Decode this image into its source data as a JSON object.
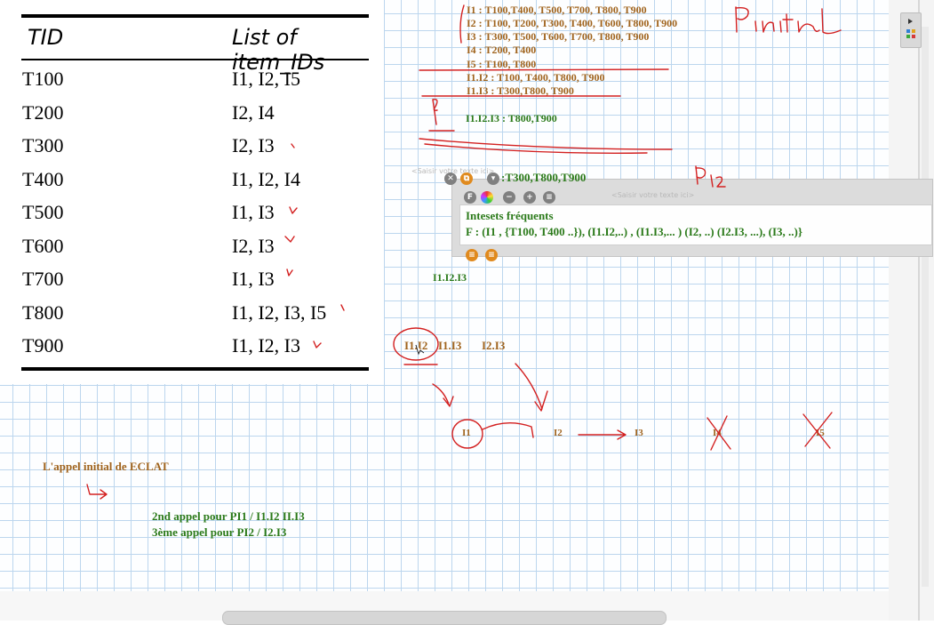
{
  "table": {
    "headers": [
      "TID",
      "List of item_IDs"
    ],
    "rows": [
      [
        "T100",
        "I1, I2, I5"
      ],
      [
        "T200",
        "I2, I4"
      ],
      [
        "T300",
        "I2, I3"
      ],
      [
        "T400",
        "I1, I2, I4"
      ],
      [
        "T500",
        "I1, I3"
      ],
      [
        "T600",
        "I2, I3"
      ],
      [
        "T700",
        "I1, I3"
      ],
      [
        "T800",
        "I1, I2, I3, I5"
      ],
      [
        "T900",
        "I1, I2, I3"
      ]
    ]
  },
  "notes": {
    "tidlists": [
      "I1 : T100,T400, T500, T700, T800, T900",
      "I2 : T100, T200, T300, T400, T600, T800, T900",
      "I3 : T300, T500, T600, T700, T800, T900",
      "I4 : T200, T400",
      "I5 : T100, T800",
      "I1.I2 : T100, T400, T800, T900",
      "I1.I3 : T300,T800, T900"
    ],
    "i1i2i3": "I1.I2.I3 : T800,T900",
    "i2i3_tail": ":T300,T800,T900",
    "i1i2i3_label": "I1.I2.I3",
    "pairs": [
      "I1.I2",
      "I1.I3",
      "I2.I3"
    ],
    "items_row": [
      "I1",
      "I2",
      "I3",
      "I4",
      "I5"
    ],
    "appel_initial": "L'appel initial de ECLAT",
    "second_call": "2nd appel pour PI1 / I1.I2 II.I3",
    "third_call": "3ème appel pour PI2 / I2.I3"
  },
  "textbox": {
    "line1": "Intesets fréquents",
    "line2": "F : (I1 , {T100, T400 ..}), (I1.I2,..) , (I1.I3,... ) (I2, ..) (I2.I3, ...), (I3, ..)}",
    "placeholder": "<Saisir votre texte ici>",
    "placeholder_left": "<Saisir votre texte ici>"
  },
  "handwriting": {
    "pinitial": "Pinitial",
    "p12": "P12",
    "pi1": "PI1"
  },
  "colors": {
    "brown": "#a0641e",
    "green": "#2b7a1a",
    "red": "#d32020",
    "grid": "#bcd6ee"
  }
}
